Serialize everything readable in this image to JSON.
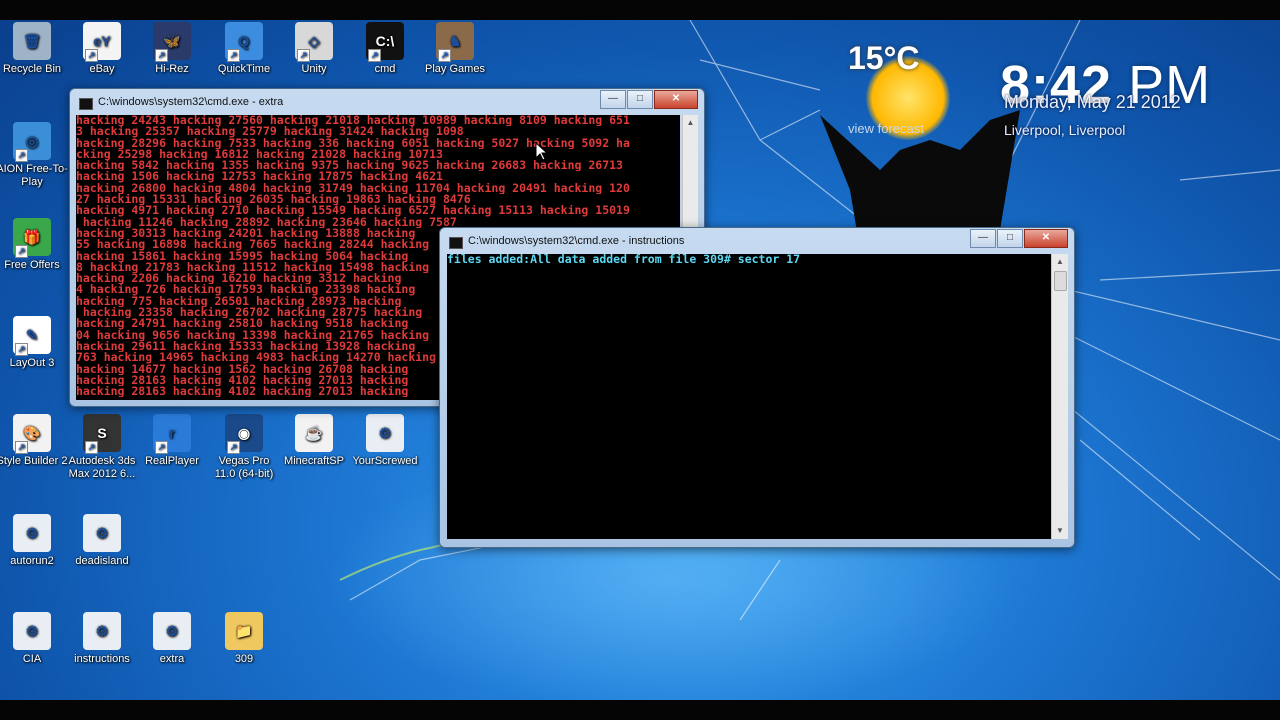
{
  "desktop_icons": [
    {
      "label": "Recycle Bin",
      "name": "recycle-bin-icon",
      "color": "#9fb3c8",
      "glyph": "🗑"
    },
    {
      "label": "eBay",
      "name": "ebay-icon",
      "color": "#f4f4f4",
      "glyph": "eY"
    },
    {
      "label": "Hi-Rez",
      "name": "hi-rez-icon",
      "color": "#2a3a6a",
      "glyph": "🦋"
    },
    {
      "label": "QuickTime",
      "name": "quicktime-icon",
      "color": "#3c8de0",
      "glyph": "Q"
    },
    {
      "label": "Unity",
      "name": "unity-icon",
      "color": "#d8d8d8",
      "glyph": "◇"
    },
    {
      "label": "cmd",
      "name": "cmd-icon",
      "color": "#111111",
      "glyph": "C:\\"
    },
    {
      "label": "Play Games",
      "name": "play-games-icon",
      "color": "#8b6a4a",
      "glyph": "♞"
    },
    {
      "label": "AION Free-To-Play",
      "name": "aion-icon",
      "color": "#3b8fd8",
      "glyph": "◎"
    },
    {
      "label": "Free Offers",
      "name": "free-offers-icon",
      "color": "#3aa84a",
      "glyph": "🎁"
    },
    {
      "label": "LayOut 3",
      "name": "layout-icon",
      "color": "#ffffff",
      "glyph": "✎"
    },
    {
      "label": "Style Builder 2",
      "name": "style-builder-icon",
      "color": "#f2f2f2",
      "glyph": "🎨"
    },
    {
      "label": "Autodesk 3ds Max 2012 6...",
      "name": "autodesk-3ds-max-icon",
      "color": "#333333",
      "glyph": "S"
    },
    {
      "label": "RealPlayer",
      "name": "realplayer-icon",
      "color": "#2a7ad8",
      "glyph": "r"
    },
    {
      "label": "Vegas Pro 11.0 (64-bit)",
      "name": "vegas-pro-icon",
      "color": "#1a4a8a",
      "glyph": "◉"
    },
    {
      "label": "MinecraftSP",
      "name": "minecraftsp-icon",
      "color": "#f2f2f2",
      "glyph": "☕"
    },
    {
      "label": "YourScrewed",
      "name": "yourscrewed-icon",
      "color": "#e8eef4",
      "glyph": "⚙"
    },
    {
      "label": "autorun2",
      "name": "autorun2-icon",
      "color": "#e8eef4",
      "glyph": "⚙"
    },
    {
      "label": "deadisland",
      "name": "deadisland-icon",
      "color": "#e8eef4",
      "glyph": "⚙"
    },
    {
      "label": "CIA",
      "name": "cia-icon",
      "color": "#e8eef4",
      "glyph": "⚙"
    },
    {
      "label": "instructions",
      "name": "instructions-icon",
      "color": "#e8eef4",
      "glyph": "⚙"
    },
    {
      "label": "extra",
      "name": "extra-icon",
      "color": "#e8eef4",
      "glyph": "⚙"
    },
    {
      "label": "309",
      "name": "folder-309-icon",
      "color": "#f0c860",
      "glyph": "📁"
    }
  ],
  "weather": {
    "temperature": "15°C",
    "forecast_link": "view forecast"
  },
  "clock": {
    "hour": "8:42",
    "ampm": "PM",
    "date": "Monday, May 21 2012",
    "location": "Liverpool, Liverpool"
  },
  "window_extra": {
    "title": "C:\\windows\\system32\\cmd.exe - extra",
    "text_color": "#e03a3a",
    "lines": [
      "hacking 24243 hacking 27560 hacking 21018 hacking 10989 hacking 8109 hacking 651",
      "3 hacking 25357 hacking 25779 hacking 31424 hacking 1098",
      "hacking 28296 hacking 7533 hacking 336 hacking 6051 hacking 5027 hacking 5092 ha",
      "cking 25298 hacking 16812 hacking 21028 hacking 10713",
      "hacking 5842 hacking 1355 hacking 9375 hacking 9625 hacking 26683 hacking 26713",
      "hacking 1506 hacking 12753 hacking 17875 hacking 4621",
      "hacking 26800 hacking 4804 hacking 31749 hacking 11704 hacking 20491 hacking 120",
      "27 hacking 15331 hacking 26035 hacking 19863 hacking 8476",
      "hacking 4971 hacking 2710 hacking 15549 hacking 6527 hacking 15113 hacking 15019",
      " hacking 11246 hacking 28892 hacking 23646 hacking 7587",
      "hacking 30313 hacking 24201 hacking 13888 hacking",
      "55 hacking 16898 hacking 7665 hacking 28244 hacking",
      "hacking 15861 hacking 15995 hacking 5064 hacking",
      "8 hacking 21783 hacking 11512 hacking 15498 hacking",
      "hacking 2206 hacking 16210 hacking 3312 hacking",
      "4 hacking 726 hacking 17593 hacking 23398 hacking",
      "hacking 775 hacking 26501 hacking 28973 hacking",
      " hacking 23358 hacking 26702 hacking 28775 hacking",
      "hacking 24791 hacking 25810 hacking 9518 hacking",
      "04 hacking 9656 hacking 13398 hacking 21765 hacking",
      "hacking 29611 hacking 15333 hacking 13928 hacking",
      "763 hacking 14965 hacking 4983 hacking 14270 hacking",
      "hacking 14677 hacking 1562 hacking 26708 hacking",
      "hacking 28163 hacking 4102 hacking 27013 hacking",
      "hacking 28163 hacking 4102 hacking 27013 hacking"
    ]
  },
  "window_instructions": {
    "title": "C:\\windows\\system32\\cmd.exe - instructions",
    "text_color": "#5ed8f2",
    "lines": [
      "files added:All data added from file 309# sector 17"
    ]
  },
  "controls": {
    "minimize": "—",
    "maximize": "□",
    "close": "✕"
  }
}
